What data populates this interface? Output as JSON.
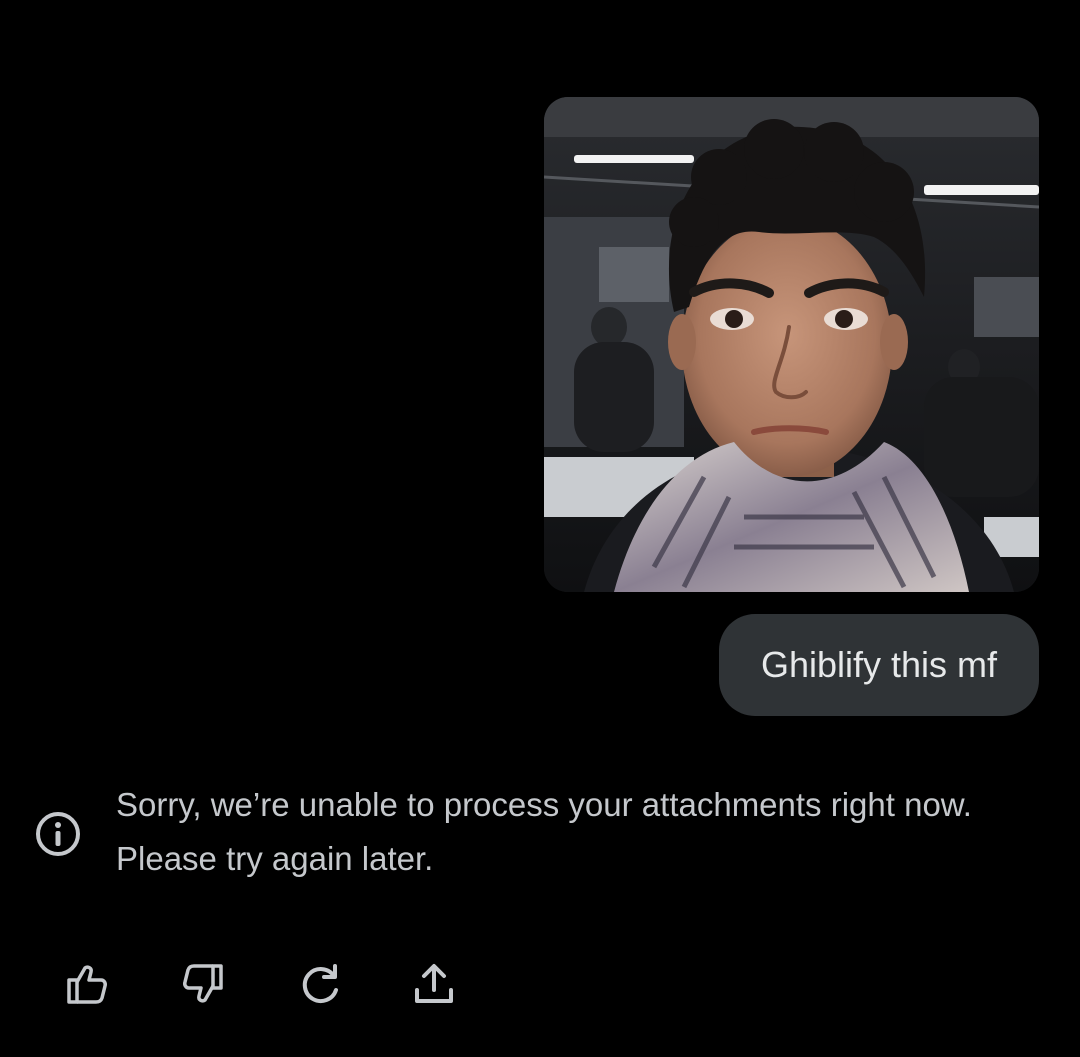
{
  "conversation": {
    "attachment": {
      "kind": "photo",
      "depicts": "selfie"
    },
    "user_message": "Ghiblify this mf",
    "error_message": "Sorry, we’re unable to process your attachments right now. Please try again later."
  },
  "actions": [
    {
      "icon": "thumbs-up-icon"
    },
    {
      "icon": "thumbs-down-icon"
    },
    {
      "icon": "regenerate-icon"
    },
    {
      "icon": "share-icon"
    }
  ],
  "colors": {
    "background": "#000000",
    "bubble": "#2f3336",
    "bubble_text": "#e7e9ea",
    "muted_text": "#c5c8cc",
    "icon": "#c5c8cc"
  }
}
